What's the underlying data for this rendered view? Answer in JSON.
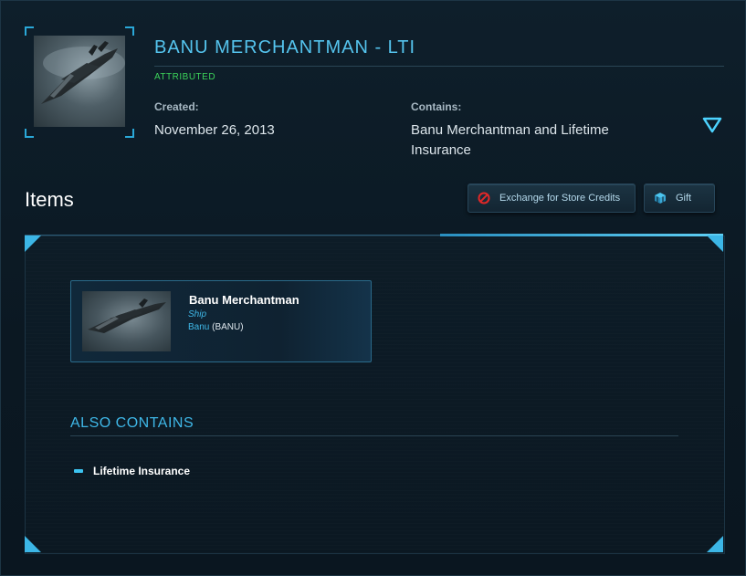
{
  "pledge": {
    "title": "BANU MERCHANTMAN - LTI",
    "status": "ATTRIBUTED",
    "created_label": "Created:",
    "created_value": "November 26, 2013",
    "contains_label": "Contains:",
    "contains_value": "Banu Merchantman and Lifetime Insurance"
  },
  "items_section": {
    "heading": "Items",
    "exchange_label": "Exchange for Store Credits",
    "gift_label": "Gift"
  },
  "item_card": {
    "name": "Banu Merchantman",
    "type": "Ship",
    "manufacturer": "Banu",
    "manufacturer_code": "(BANU)"
  },
  "also_contains": {
    "heading": "ALSO CONTAINS",
    "items": [
      "Lifetime Insurance"
    ]
  },
  "colors": {
    "accent": "#55c4ee",
    "status_green": "#3cd35a",
    "background": "#0b1822"
  },
  "icons": [
    "expand-arrow-icon",
    "no-entry-icon",
    "gift-box-icon"
  ]
}
